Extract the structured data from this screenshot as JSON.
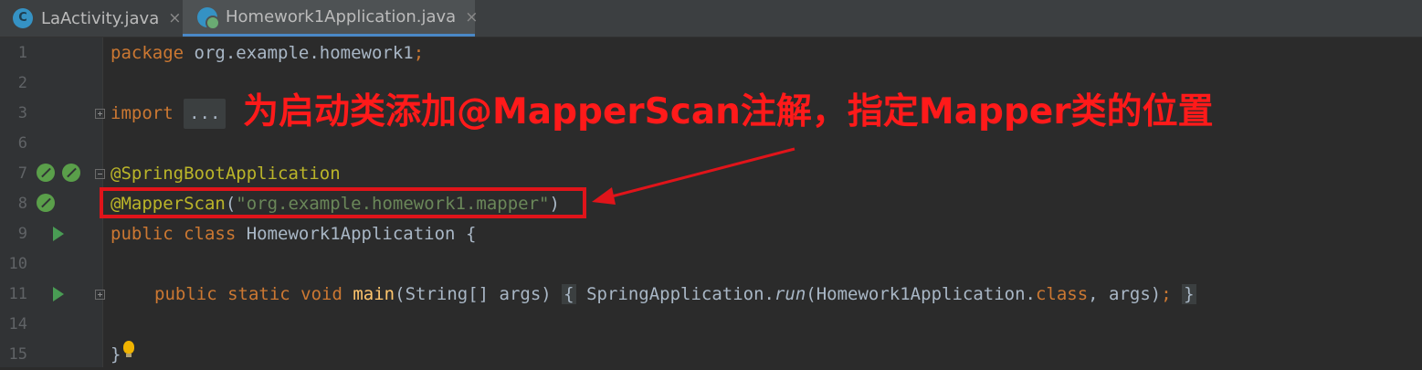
{
  "tabs": [
    {
      "label": "LaActivity.java",
      "icon": "class-c-icon",
      "active": false
    },
    {
      "label": "Homework1Application.java",
      "icon": "spring-class-icon",
      "active": true
    }
  ],
  "close_glyph": "×",
  "editor": {
    "lines": [
      {
        "num": "1",
        "parts": {
          "p1": "package",
          "p2": " org.example.homework1",
          "p3": ";"
        }
      },
      {
        "num": "2"
      },
      {
        "num": "3",
        "parts": {
          "p1": "import",
          "p2": "..."
        }
      },
      {
        "num": "6"
      },
      {
        "num": "7",
        "parts": {
          "p1": "@SpringBootApplication"
        }
      },
      {
        "num": "8",
        "parts": {
          "p1": "@MapperScan",
          "p2": "(",
          "p3": "\"org.example.homework1.mapper\"",
          "p4": ")"
        }
      },
      {
        "num": "9",
        "parts": {
          "p1": "public class",
          "p2": " Homework1Application {"
        }
      },
      {
        "num": "10"
      },
      {
        "num": "11",
        "parts": {
          "p1": "public static void",
          "p2": "main",
          "p3": "(String[] args)",
          "p4": "{",
          "p5": " SpringApplication.",
          "p6": "run",
          "p7": "(Homework1Application.",
          "p8": "class",
          "p9": ", args)",
          "p10": ";",
          "p11": "}"
        }
      },
      {
        "num": "14"
      },
      {
        "num": "15",
        "parts": {
          "p1": "}"
        }
      }
    ]
  },
  "annotation": {
    "callout_text": "为启动类添加@MapperScan注解，指定Mapper类的位置",
    "color": "#e0141a"
  }
}
